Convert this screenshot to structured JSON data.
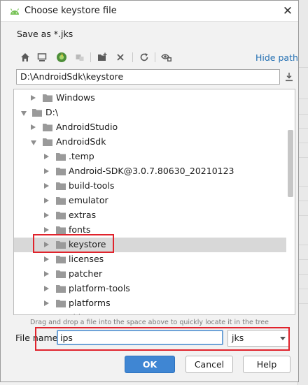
{
  "window": {
    "title": "Choose keystore file",
    "close_glyph": "✕"
  },
  "dialog": {
    "subtitle": "Save as *.jks"
  },
  "toolbar": {
    "hide_path_label": "Hide path",
    "icons": [
      "home-icon",
      "desktop-icon",
      "project-icon",
      "module-icon",
      "new-folder-icon",
      "delete-icon",
      "refresh-icon",
      "show-hidden-icon"
    ]
  },
  "path": {
    "value": "D:\\AndroidSdk\\keystore"
  },
  "tree": {
    "items": [
      {
        "label": "Windows",
        "depth": 1,
        "expanded": false,
        "selected": false
      },
      {
        "label": "D:\\",
        "depth": 0,
        "expanded": true,
        "selected": false
      },
      {
        "label": "AndroidStudio",
        "depth": 1,
        "expanded": false,
        "selected": false
      },
      {
        "label": "AndroidSdk",
        "depth": 1,
        "expanded": true,
        "selected": false
      },
      {
        "label": ".temp",
        "depth": 2,
        "expanded": false,
        "selected": false
      },
      {
        "label": "Android-SDK@3.0.7.80630_20210123",
        "depth": 2,
        "expanded": false,
        "selected": false
      },
      {
        "label": "build-tools",
        "depth": 2,
        "expanded": false,
        "selected": false
      },
      {
        "label": "emulator",
        "depth": 2,
        "expanded": false,
        "selected": false
      },
      {
        "label": "extras",
        "depth": 2,
        "expanded": false,
        "selected": false
      },
      {
        "label": "fonts",
        "depth": 2,
        "expanded": false,
        "selected": false
      },
      {
        "label": "keystore",
        "depth": 2,
        "expanded": false,
        "selected": true
      },
      {
        "label": "licenses",
        "depth": 2,
        "expanded": false,
        "selected": false
      },
      {
        "label": "patcher",
        "depth": 2,
        "expanded": false,
        "selected": false
      },
      {
        "label": "platform-tools",
        "depth": 2,
        "expanded": false,
        "selected": false
      },
      {
        "label": "platforms",
        "depth": 2,
        "expanded": false,
        "selected": false
      },
      {
        "label": "skin-parser",
        "depth": 2,
        "expanded": false,
        "selected": false
      }
    ]
  },
  "hint": "Drag and drop a file into the space above to quickly locate it in the tree",
  "file_name": {
    "label": "File name:",
    "value": "ips"
  },
  "file_type": {
    "value": "jks"
  },
  "buttons": {
    "ok": "OK",
    "cancel": "Cancel",
    "help": "Help"
  },
  "colors": {
    "accent": "#3f86d3",
    "link": "#2470b3",
    "highlight": "#e0232c",
    "selection": "#d8d8d8",
    "folder": "#9a9a9a"
  }
}
